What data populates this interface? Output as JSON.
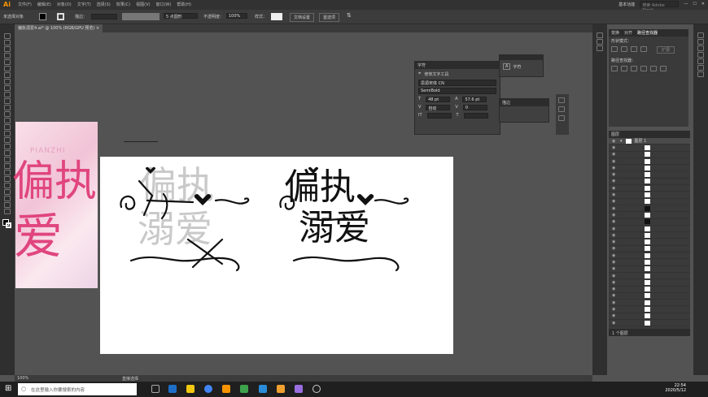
{
  "app": {
    "logo": "Ai",
    "menus": [
      "文件(F)",
      "编辑(E)",
      "对象(O)",
      "文字(T)",
      "选择(S)",
      "效果(C)",
      "视图(V)",
      "窗口(W)",
      "帮助(H)"
    ],
    "workspace": "基本功能",
    "search_placeholder": "搜索 Adobe Stock"
  },
  "control_bar": {
    "selection": "未选择对象",
    "stroke_label": "描边：",
    "stroke_value": "5 点圆形",
    "opacity_label": "不透明度：",
    "opacity_value": "100%",
    "style_label": "样式：",
    "doc_setup": "文档设置",
    "prefs": "首选项"
  },
  "document": {
    "tab": "偏执溺爱4.ai* @ 100% (RGB/GPU 预览)"
  },
  "character_panel": {
    "tab": "字符",
    "touch": "修饰文字工具",
    "font": "思源宋体 CN",
    "style": "SemiBold",
    "size": "48 pt",
    "leading": "57.6 pt",
    "kerning": "自动",
    "tracking": "0"
  },
  "glyph_panel": {
    "tab": "字符"
  },
  "stroke_panel": {
    "tab": "描边"
  },
  "right_panel": {
    "tabs": [
      "变换",
      "对齐",
      "路径查找器"
    ],
    "shape_modes": "形状模式：",
    "expand": "扩展",
    "pathfinders": "路径查找器："
  },
  "layers_panel": {
    "tab": "图层",
    "layer_name": "图层 1",
    "footer": "1 个图层"
  },
  "artwork": {
    "line1": "偏执",
    "line2": "溺爱",
    "poster_latin": "PIANZHI",
    "poster_line1": "偏执",
    "poster_line2": "爱"
  },
  "status": {
    "zoom": "100%",
    "tool": "直接选择"
  },
  "taskbar": {
    "search": "在这里输入你要搜索的内容",
    "time": "22:54",
    "date": "2020/5/12"
  }
}
